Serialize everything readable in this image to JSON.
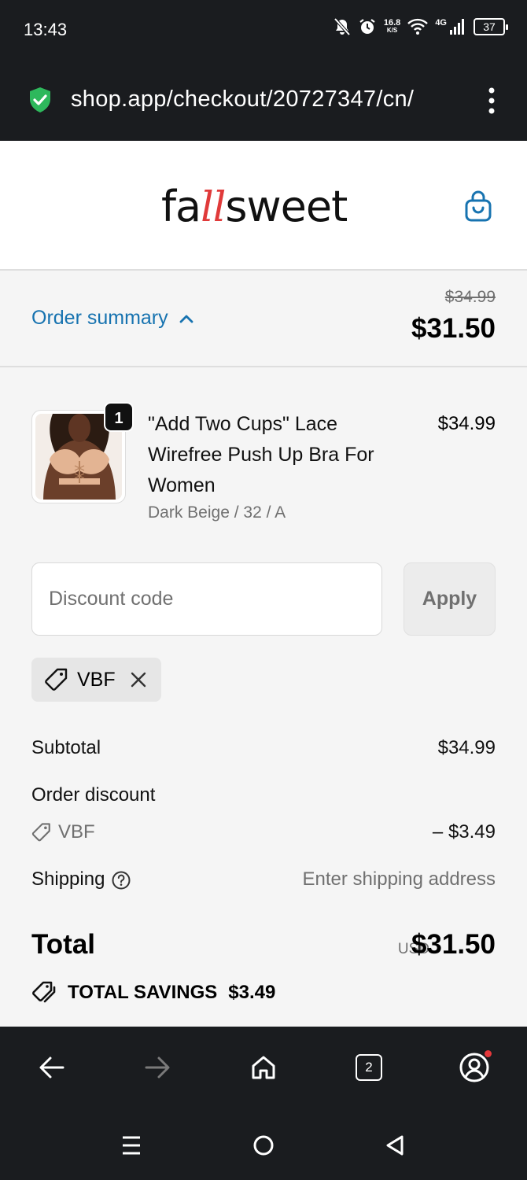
{
  "status_bar": {
    "time": "13:43",
    "net_speed_value": "16.8",
    "net_speed_unit": "K/S",
    "network_type": "4G",
    "battery": "37"
  },
  "browser": {
    "url": "shop.app/checkout/20727347/cn/",
    "tab_count": "2"
  },
  "store": {
    "logo_prefix": "fa",
    "logo_ll": "ll",
    "logo_suffix": "sweet"
  },
  "summary": {
    "toggle_label": "Order summary",
    "original_price": "$34.99",
    "total_price": "$31.50"
  },
  "product": {
    "quantity": "1",
    "title": "\"Add Two Cups\" Lace Wirefree Push Up Bra For Women",
    "variant": "Dark Beige / 32 / A",
    "price": "$34.99"
  },
  "discount": {
    "placeholder": "Discount code",
    "apply_label": "Apply",
    "applied_code": "VBF"
  },
  "totals": {
    "subtotal_label": "Subtotal",
    "subtotal_value": "$34.99",
    "order_discount_label": "Order discount",
    "discount_code": "VBF",
    "discount_value": "– $3.49",
    "shipping_label": "Shipping",
    "shipping_value": "Enter shipping address",
    "total_label": "Total",
    "currency": "USD",
    "total_value": "$31.50",
    "savings_label": "TOTAL SAVINGS",
    "savings_value": "$3.49"
  },
  "colors": {
    "link": "#1773b0",
    "bar_bg": "#1a1c1f",
    "secure_green": "#2eb85c",
    "logo_accent": "#e03a3a"
  },
  "icons": {
    "secure": "shield-check-icon",
    "bag": "shopping-bag-icon",
    "chevron": "chevron-up-icon",
    "tag": "tag-icon",
    "remove": "close-icon",
    "help": "question-circle-icon",
    "savings": "tags-icon",
    "back": "arrow-left-icon",
    "forward": "arrow-right-icon",
    "home": "home-icon",
    "tabs": "tabs-icon",
    "profile": "account-icon"
  }
}
